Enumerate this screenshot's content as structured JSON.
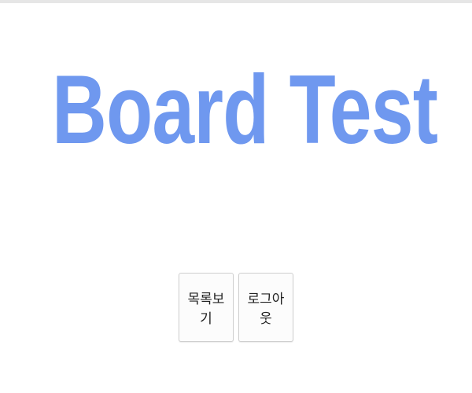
{
  "header": {
    "title": "Board Test",
    "title_color": "#6f98ef"
  },
  "actions": {
    "list_label": "목록보기",
    "logout_label": "로그아웃"
  }
}
